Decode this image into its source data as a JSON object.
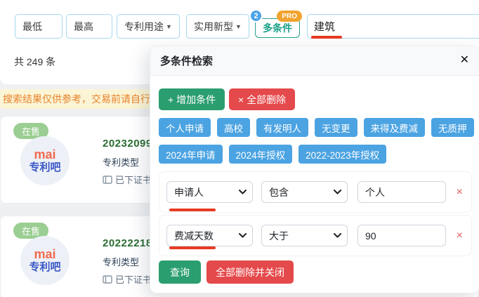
{
  "toolbar": {
    "min_label": "最低",
    "max_label": "最高",
    "patent_use_label": "专利用途",
    "utility_model_label": "实用新型",
    "caret": "▼",
    "multi_condition_label": "多条件",
    "badge_count": "2",
    "pro_label": "PRO",
    "search_value": "建筑"
  },
  "results": {
    "count_text": "共 249 条",
    "notice_text": "搜索结果仅供参考，交易前请自行核实"
  },
  "listings": [
    {
      "status": "在售",
      "logo_line1": "mai",
      "logo_line2": "专利吧",
      "patent_no": "20232099",
      "type_label": "专利类型",
      "cert_text": "已下证书"
    },
    {
      "status": "在售",
      "logo_line1": "mai",
      "logo_line2": "专利吧",
      "patent_no": "20222218",
      "type_label": "专利类型",
      "cert_text": "已下证书"
    }
  ],
  "modal": {
    "title": "多条件检索",
    "close_icon": "✕",
    "add_button": "+ 增加条件",
    "delete_all_button": "× 全部删除",
    "tags_row1": [
      "个人申请",
      "高校",
      "有发明人",
      "无变更",
      "来得及费减",
      "无质押"
    ],
    "tags_row2": [
      "2024年申请",
      "2024年授权",
      "2022-2023年授权"
    ],
    "conditions": [
      {
        "field": "申请人",
        "operator": "包含",
        "value": "个人",
        "remove_icon": "×"
      },
      {
        "field": "费减天数",
        "operator": "大于",
        "value": "90",
        "remove_icon": "×"
      }
    ],
    "query_button": "查询",
    "delete_close_button": "全部删除并关闭"
  },
  "colors": {
    "accent_teal": "#1ba088",
    "accent_blue": "#4ba3e2",
    "accent_green": "#2b9e6f",
    "accent_red": "#e4494b",
    "badge_blue": "#4aa3e8",
    "pro_orange": "#f2a32d",
    "notice_bg": "#fcf5d5",
    "notice_text": "#e8822d",
    "patent_green": "#2b6e33",
    "onsale_green": "#9bce92",
    "annotation_red": "#e83a23"
  }
}
